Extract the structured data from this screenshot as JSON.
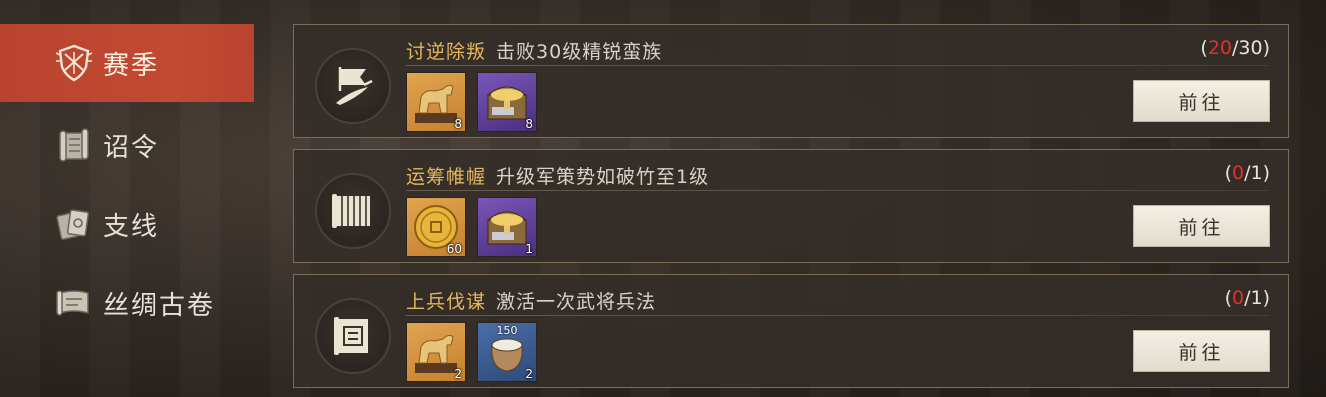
{
  "sidebar": {
    "items": [
      {
        "label": "赛季",
        "icon": "season-shield-icon",
        "active": true
      },
      {
        "label": "诏令",
        "icon": "scroll-edict-icon",
        "active": false
      },
      {
        "label": "支线",
        "icon": "cards-branch-icon",
        "active": false
      },
      {
        "label": "丝绸古卷",
        "icon": "silk-scroll-icon",
        "active": false
      }
    ]
  },
  "quests": [
    {
      "name": "讨逆除叛",
      "desc": "击败30级精锐蛮族",
      "progress_open": "(",
      "progress_current": "20",
      "progress_total": "/30)",
      "button": "前往",
      "emblem": "flag-sword-icon",
      "rewards": [
        {
          "kind": "bronze-horse",
          "rarity": "gold",
          "count": "8"
        },
        {
          "kind": "treasure-chest",
          "rarity": "purple",
          "count": "8"
        }
      ]
    },
    {
      "name": "运筹帷幄",
      "desc": "升级军策势如破竹至1级",
      "progress_open": "(",
      "progress_current": "0",
      "progress_total": "/1)",
      "button": "前往",
      "emblem": "bamboo-slips-icon",
      "rewards": [
        {
          "kind": "gold-coin",
          "rarity": "gold",
          "count": "60"
        },
        {
          "kind": "treasure-chest",
          "rarity": "purple",
          "count": "1"
        }
      ]
    },
    {
      "name": "上兵伐谋",
      "desc": "激活一次武将兵法",
      "progress_open": "(",
      "progress_current": "0",
      "progress_total": "/1)",
      "button": "前往",
      "emblem": "scroll-map-icon",
      "rewards": [
        {
          "kind": "bronze-horse",
          "rarity": "gold",
          "count": "2"
        },
        {
          "kind": "grain-sack",
          "rarity": "blue",
          "count": "2",
          "top_label": "150"
        }
      ]
    }
  ],
  "colors": {
    "accent_red": "#c24a33",
    "title_gold": "#e4b75c",
    "progress_red": "#e0312a"
  }
}
